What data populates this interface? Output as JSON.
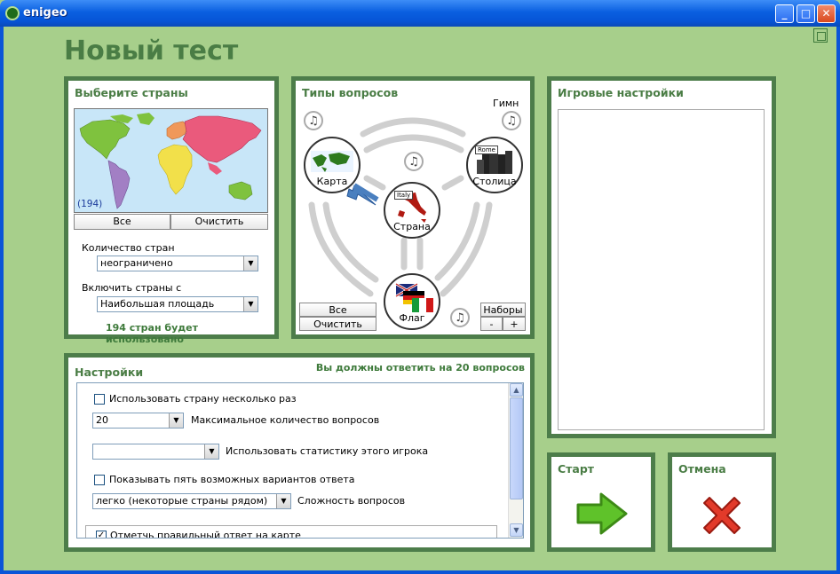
{
  "window": {
    "title": "enigeo"
  },
  "page_title": "Новый тест",
  "countries": {
    "title": "Выберите страны",
    "map_count": "(194)",
    "all_button": "Все",
    "clear_button": "Очистить",
    "count_label": "Количество стран",
    "count_value": "неограничено",
    "include_label": "Включить страны с",
    "include_value": "Наибольшая площадь",
    "summary": "194 стран будет использовано"
  },
  "question_types": {
    "title": "Типы вопросов",
    "anthem_label": "Гимн",
    "nodes": {
      "map": "Карта",
      "capital": "Столица",
      "country": "Страна",
      "flag": "Флаг"
    },
    "country_tag": "Italy",
    "capital_tag": "Rome",
    "all_button": "Все",
    "clear_button": "Очистить",
    "sets_button": "Наборы",
    "minus_button": "-",
    "plus_button": "+"
  },
  "game_settings": {
    "title": "Игровые настройки"
  },
  "settings": {
    "title": "Настройки",
    "requirement": "Вы должны ответить на 20 вопросов",
    "use_country_multiple": "Использовать страну несколько раз",
    "max_questions_value": "20",
    "max_questions_label": "Максимальное количество вопросов",
    "player_stats_value": "",
    "player_stats_label": "Использовать статистику этого игрока",
    "show_five_options": "Показывать пять возможных вариантов ответа",
    "difficulty_value": "легко (некоторые страны рядом)",
    "difficulty_label": "Сложность вопросов",
    "mark_on_map": "Отметчь правильный ответ на карте"
  },
  "start": {
    "title": "Старт"
  },
  "cancel": {
    "title": "Отмена"
  },
  "colors": {
    "panel_border": "#4d7d4a",
    "background": "#a7cf8b",
    "accent_text": "#4a7d45"
  }
}
